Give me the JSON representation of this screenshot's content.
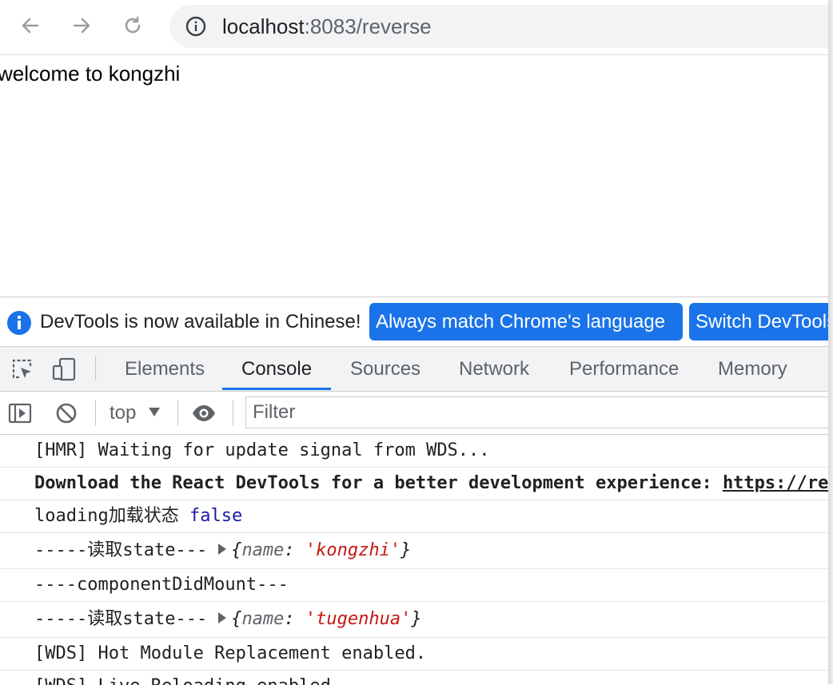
{
  "browser": {
    "url_host": "localhost",
    "url_path": ":8083/reverse"
  },
  "page": {
    "welcome_text": "welcome to kongzhi"
  },
  "devtools": {
    "language_bar": {
      "message": "DevTools is now available in Chinese!",
      "match_button": "Always match Chrome's language",
      "switch_button": "Switch DevTools to Chinese"
    },
    "tabs": [
      {
        "label": "Elements",
        "active": false
      },
      {
        "label": "Console",
        "active": true
      },
      {
        "label": "Sources",
        "active": false
      },
      {
        "label": "Network",
        "active": false
      },
      {
        "label": "Performance",
        "active": false
      },
      {
        "label": "Memory",
        "active": false
      }
    ],
    "toolbar": {
      "context": "top",
      "filter_placeholder": "Filter"
    },
    "console_lines": {
      "hmr_waiting": "[HMR] Waiting for update signal from WDS...",
      "react_devtools": "Download the React DevTools for a better development experience: ",
      "react_devtools_link": "https://reactjs.org/link/react-devtools",
      "loading_label": "loading加载状态",
      "loading_value": "false",
      "read_state_prefix_1": "-----读取state---",
      "state_key_1": "name",
      "state_value_1": "'kongzhi'",
      "component_did_mount": "----componentDidMount---",
      "read_state_prefix_2": "-----读取state---",
      "state_key_2": "name",
      "state_value_2": "'tugenhua'",
      "wds_hmr": "[WDS] Hot Module Replacement enabled.",
      "wds_live": "[WDS] Live Reloading enabled."
    }
  },
  "colors": {
    "accent": "#1a73e8",
    "string_red": "#c41a16",
    "keyword_blue": "#1a1aa6"
  }
}
